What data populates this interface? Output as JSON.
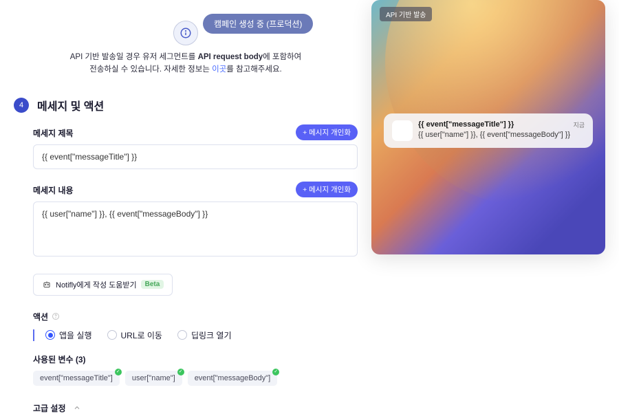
{
  "status_pill": "캠페인 생성 중 (프로덕션)",
  "info": {
    "line1_prefix": "API 기반 발송일 경우 유저 세그먼트를 ",
    "line1_bold": "API request body",
    "line1_suffix": "에 포함하여",
    "line2_prefix": "전송하실 수 있습니다. 자세한 정보는 ",
    "link": "이곳",
    "line2_suffix": "를 참고해주세요."
  },
  "section": {
    "step": "4",
    "title": "메세지 및 액션"
  },
  "form": {
    "title_label": "메세지 제목",
    "title_value": "{{ event[\"messageTitle\"] }}",
    "body_label": "메세지 내용",
    "body_value": "{{ user[\"name\"] }}, {{ event[\"messageBody\"] }}",
    "personalize_btn": "+ 메시지 개인화",
    "helper_btn": "Notifly에게 작성 도움받기",
    "beta": "Beta"
  },
  "action": {
    "label": "액션",
    "options": [
      "앱을 실행",
      "URL로 이동",
      "딥링크 열기"
    ],
    "selected": 0
  },
  "vars": {
    "label": "사용된 변수 (3)",
    "items": [
      "event[\"messageTitle\"]",
      "user[\"name\"]",
      "event[\"messageBody\"]"
    ]
  },
  "advanced": "고급 설정",
  "preview": {
    "tag": "API 기반 발송",
    "notif_title": "{{ event[\"messageTitle\"] }}",
    "notif_body": "{{ user[\"name\"] }}, {{ event[\"messageBody\"] }}",
    "time": "지금"
  }
}
